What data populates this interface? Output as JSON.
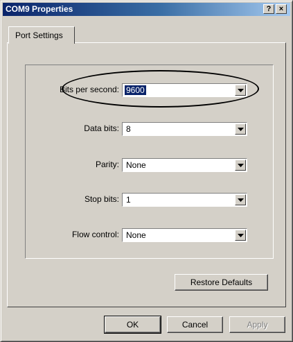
{
  "window": {
    "title": "COM9 Properties",
    "help_label": "?",
    "close_label": "×"
  },
  "tabs": [
    {
      "label": "Port Settings"
    }
  ],
  "settings": {
    "bits_per_second": {
      "label": "Bits per second:",
      "value": "9600"
    },
    "data_bits": {
      "label": "Data bits:",
      "value": "8"
    },
    "parity": {
      "label": "Parity:",
      "value": "None"
    },
    "stop_bits": {
      "label": "Stop bits:",
      "value": "1"
    },
    "flow_control": {
      "label": "Flow control:",
      "value": "None"
    }
  },
  "buttons": {
    "restore_defaults": "Restore Defaults",
    "ok": "OK",
    "cancel": "Cancel",
    "apply": "Apply"
  },
  "colors": {
    "titlebar_start": "#0a246a",
    "titlebar_end": "#a6caf0",
    "dialog_face": "#d4d0c8",
    "selection": "#0a246a"
  }
}
